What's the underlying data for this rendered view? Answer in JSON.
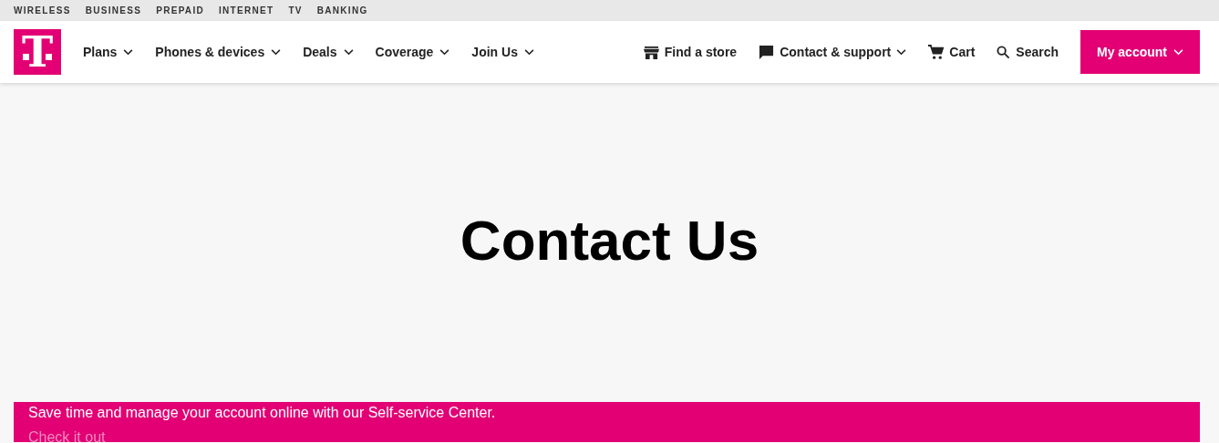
{
  "top_links": [
    "WIRELESS",
    "BUSINESS",
    "PREPAID",
    "INTERNET",
    "TV",
    "BANKING"
  ],
  "logo": {
    "letter": "T"
  },
  "nav": [
    {
      "label": "Plans",
      "dropdown": true
    },
    {
      "label": "Phones & devices",
      "dropdown": true
    },
    {
      "label": "Deals",
      "dropdown": true
    },
    {
      "label": "Coverage",
      "dropdown": true
    },
    {
      "label": "Join Us",
      "dropdown": true
    }
  ],
  "utility": [
    {
      "kind": "store",
      "label": "Find a store",
      "dropdown": false
    },
    {
      "kind": "chat",
      "label": "Contact & support",
      "dropdown": true
    },
    {
      "kind": "cart",
      "label": "Cart",
      "dropdown": false
    },
    {
      "kind": "search",
      "label": "Search",
      "dropdown": false
    }
  ],
  "account_button": {
    "label": "My account",
    "dropdown": true
  },
  "hero": {
    "title": "Contact Us"
  },
  "banner": {
    "text": "Save time and manage your account online with our Self-service Center.",
    "link": "Check it out"
  }
}
